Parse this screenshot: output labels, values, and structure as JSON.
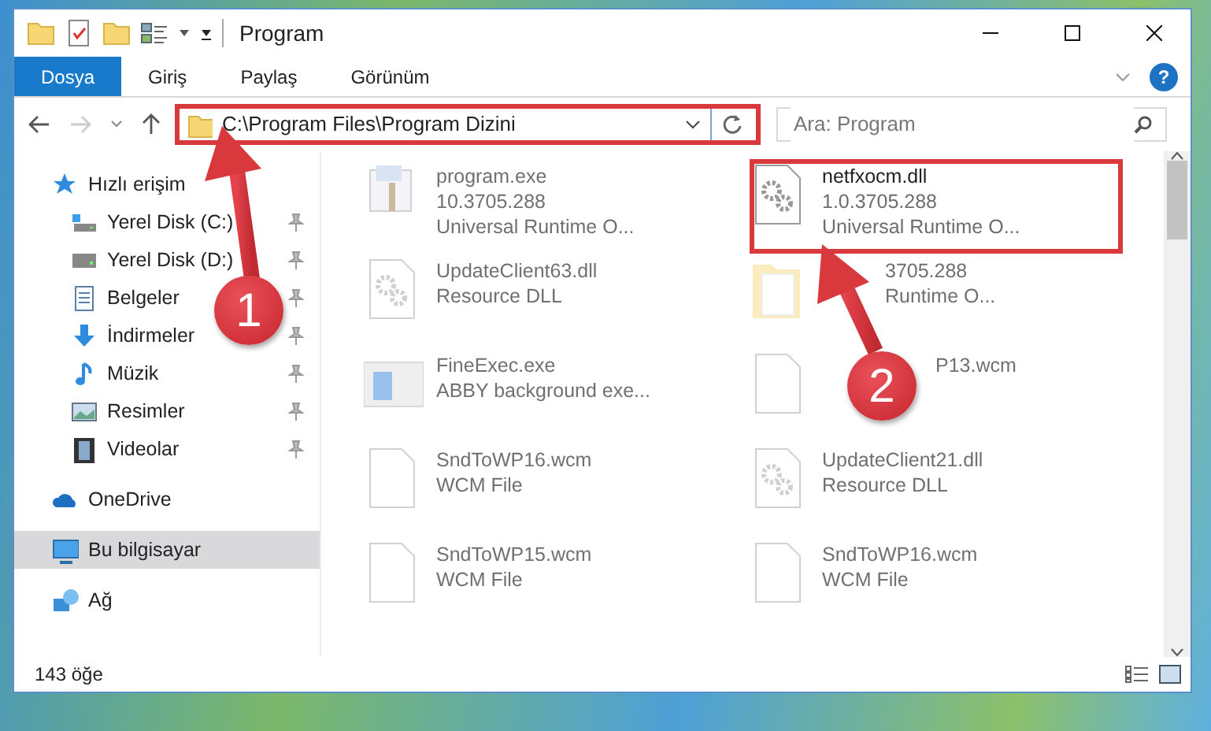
{
  "window": {
    "title": "Program"
  },
  "ribbon": {
    "tabs": [
      {
        "label": "Dosya",
        "selected": true
      },
      {
        "label": "Giriş",
        "selected": false
      },
      {
        "label": "Paylaş",
        "selected": false
      },
      {
        "label": "Görünüm",
        "selected": false
      }
    ],
    "help": "?"
  },
  "address": {
    "path": "C:\\Program Files\\Program Dizini",
    "search_placeholder": "Ara: Program",
    "forward_disabled": true
  },
  "sidebar": {
    "items": [
      {
        "label": "Hızlı erişim",
        "kind": "star",
        "selected": false,
        "children": [
          {
            "label": "Yerel Disk (C:)",
            "kind": "drive-c",
            "pinned": true,
            "selected": false
          },
          {
            "label": "Yerel Disk (D:)",
            "kind": "drive",
            "pinned": true,
            "selected": false
          },
          {
            "label": "Belgeler",
            "kind": "document",
            "pinned": true,
            "selected": false
          },
          {
            "label": "İndirmeler",
            "kind": "download",
            "pinned": true,
            "selected": false
          },
          {
            "label": "Müzik",
            "kind": "music",
            "pinned": true,
            "selected": false
          },
          {
            "label": "Resimler",
            "kind": "picture",
            "pinned": true,
            "selected": false
          },
          {
            "label": "Videolar",
            "kind": "video",
            "pinned": true,
            "selected": false
          }
        ]
      },
      {
        "label": "OneDrive",
        "kind": "cloud",
        "selected": false
      },
      {
        "label": "Bu bilgisayar",
        "kind": "computer",
        "selected": true
      },
      {
        "label": "Ağ",
        "kind": "network",
        "selected": false
      }
    ]
  },
  "files": [
    {
      "kind": "exe",
      "faded": true,
      "lines": [
        "program.exe",
        "10.3705.288",
        "Universal Runtime O..."
      ]
    },
    {
      "kind": "dll",
      "faded": false,
      "lines": [
        "netfxocm.dll",
        "1.0.3705.288",
        "Universal Runtime O..."
      ]
    },
    {
      "kind": "dll",
      "faded": true,
      "lines": [
        "UpdateClient63.dll",
        "Resource DLL"
      ]
    },
    {
      "kind": "folder",
      "faded": true,
      "covered": true,
      "lines": [
        "3705.288",
        "Runtime O..."
      ]
    },
    {
      "kind": "app",
      "faded": true,
      "lines": [
        "FineExec.exe",
        "ABBY background exe..."
      ]
    },
    {
      "kind": "file",
      "faded": true,
      "covered": true,
      "lines": [
        "P13.wcm"
      ]
    },
    {
      "kind": "file",
      "faded": true,
      "lines": [
        "SndToWP16.wcm",
        "WCM File"
      ]
    },
    {
      "kind": "dll",
      "faded": true,
      "lines": [
        "UpdateClient21.dll",
        "Resource DLL"
      ]
    },
    {
      "kind": "file",
      "faded": true,
      "lines": [
        "SndToWP15.wcm",
        "WCM File"
      ]
    },
    {
      "kind": "file",
      "faded": true,
      "lines": [
        "SndToWP16.wcm",
        "WCM File"
      ]
    }
  ],
  "status_bar": {
    "count": "143 öğe"
  },
  "callouts": [
    {
      "number": "1"
    },
    {
      "number": "2"
    }
  ]
}
